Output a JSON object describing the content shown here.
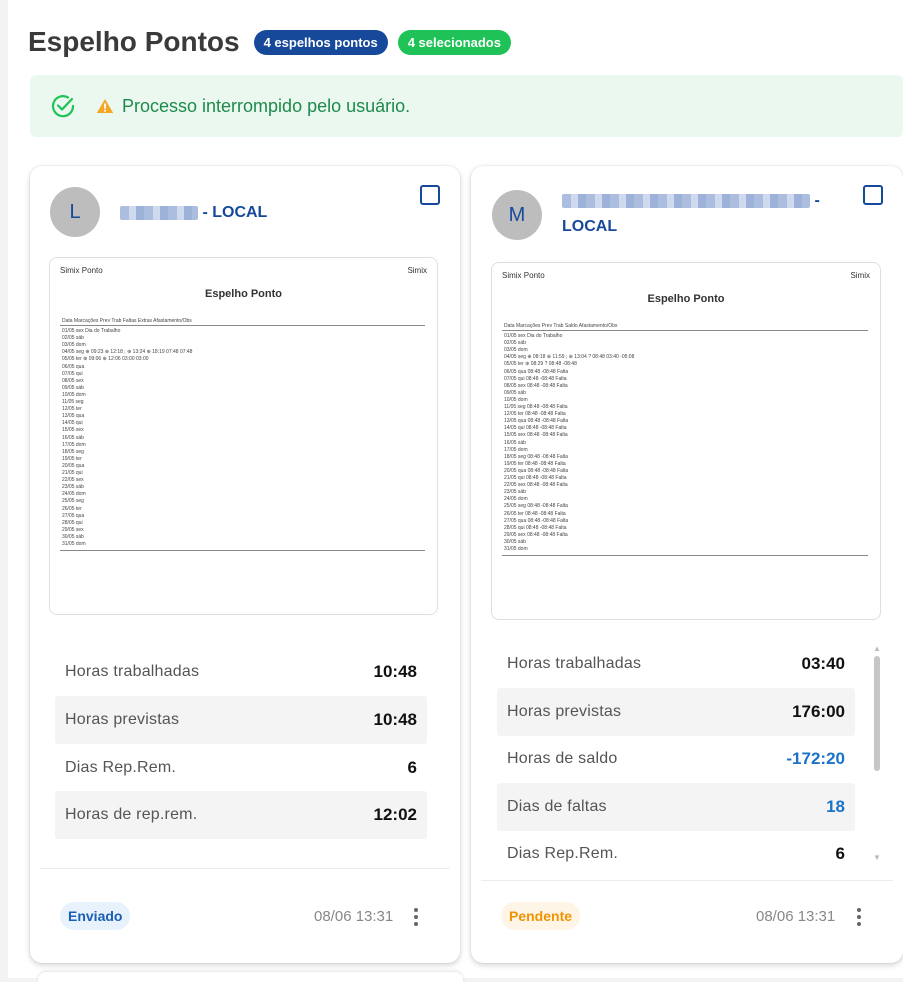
{
  "page": {
    "title": "Espelho Pontos",
    "badge_total": "4 espelhos pontos",
    "badge_selected": "4 selecionados"
  },
  "alert": {
    "message": "Processo interrompido pelo usuário.",
    "check_icon": "check-circle-icon",
    "warning_icon": "warning-triangle-icon",
    "color": "#1f8a4c"
  },
  "cards": [
    {
      "avatar": "L",
      "name_suffix": "- LOCAL",
      "doc": {
        "brand_left": "Simix Ponto",
        "brand_right": "Simix",
        "title": "Espelho Ponto",
        "columns": "Data      Marcações                                             Prev   Trab   Faltas   Extras   Afastamento/Obs",
        "rows": [
          "01/05 sex                                                                                                   Dia do Trabalho",
          "02/05 sáb",
          "03/05 dom",
          "04/05 seg    ⊕ 09:23  ⊕ 12:18  ;  ⊕ 13:24  ⊕ 18:19       07:48    07:48",
          "05/05 ter    ⊕ 09:06  ⊕ 12:06                                     03:00    03:00",
          "06/05 qua",
          "07/05 qui",
          "08/05 sex",
          "09/05 sáb",
          "10/05 dom",
          "11/05 seg",
          "12/05 ter",
          "13/05 qua",
          "14/05 qui",
          "15/05 sex",
          "16/05 sáb",
          "17/05 dom",
          "18/05 seg",
          "19/05 ter",
          "20/05 qua",
          "21/05 qui",
          "22/05 sex",
          "23/05 sáb",
          "24/05 dom",
          "25/05 seg",
          "26/05 ter",
          "27/05 qua",
          "28/05 qui",
          "29/05 sex",
          "30/05 sáb",
          "31/05 dom"
        ]
      },
      "stats": [
        {
          "label": "Horas trabalhadas",
          "value": "10:48"
        },
        {
          "label": "Horas previstas",
          "value": "10:48"
        },
        {
          "label": "Dias Rep.Rem.",
          "value": "6"
        },
        {
          "label": "Horas de rep.rem.",
          "value": "12:02"
        }
      ],
      "status": "Enviado",
      "timestamp": "08/06 13:31"
    },
    {
      "avatar": "M",
      "name_suffix": "-",
      "name_line2": "LOCAL",
      "doc": {
        "brand_left": "Simix Ponto",
        "brand_right": "Simix",
        "title": "Espelho Ponto",
        "columns": "Data      Marcações                                             Prev   Trab   Saldo   Afastamento/Obs",
        "rows": [
          "01/05 sex                                                                                  Dia do Trabalho",
          "02/05 sáb",
          "03/05 dom",
          "04/05 seg    ⊕ 08:18  ⊕ 11:59  ;  ⊕ 13:04  ?        08:48   03:40   -05:08",
          "05/05 ter    ⊕ 08:29  ?                                        08:48            -08:48",
          "06/05 qua                                                         08:48            -08:48   Falta",
          "07/05 qui                                                          08:48            -08:48   Falta",
          "08/05 sex                                                          08:48            -08:48   Falta",
          "09/05 sáb",
          "10/05 dom",
          "11/05 seg                                                          08:48            -08:48   Falta",
          "12/05 ter                                                           08:48            -08:48   Falta",
          "13/05 qua                                                         08:48            -08:48   Falta",
          "14/05 qui                                                          08:48            -08:48   Falta",
          "15/05 sex                                                          08:48            -08:48   Falta",
          "16/05 sáb",
          "17/05 dom",
          "18/05 seg                                                          08:48            -08:48   Falta",
          "19/05 ter                                                           08:48            -08:48   Falta",
          "20/05 qua                                                         08:48            -08:48   Falta",
          "21/05 qui                                                          08:48            -08:48   Falta",
          "22/05 sex                                                          08:48            -08:48   Falta",
          "23/05 sáb",
          "24/05 dom",
          "25/05 seg                                                          08:48            -08:48   Falta",
          "26/05 ter                                                           08:48            -08:48   Falta",
          "27/05 qua                                                         08:48            -08:48   Falta",
          "28/05 qui                                                          08:48            -08:48   Falta",
          "29/05 sex                                                          08:48            -08:48   Falta",
          "30/05 sáb",
          "31/05 dom"
        ]
      },
      "stats": [
        {
          "label": "Horas trabalhadas",
          "value": "03:40"
        },
        {
          "label": "Horas previstas",
          "value": "176:00"
        },
        {
          "label": "Horas de saldo",
          "value": "-172:20"
        },
        {
          "label": "Dias de faltas",
          "value": "18"
        },
        {
          "label": "Dias Rep.Rem.",
          "value": "6"
        }
      ],
      "status": "Pendente",
      "timestamp": "08/06 13:31"
    }
  ],
  "colors": {
    "brand_blue": "#17499a",
    "success_green": "#1fc257",
    "value_blue": "#1a73c8",
    "pending_orange": "#f39200"
  }
}
